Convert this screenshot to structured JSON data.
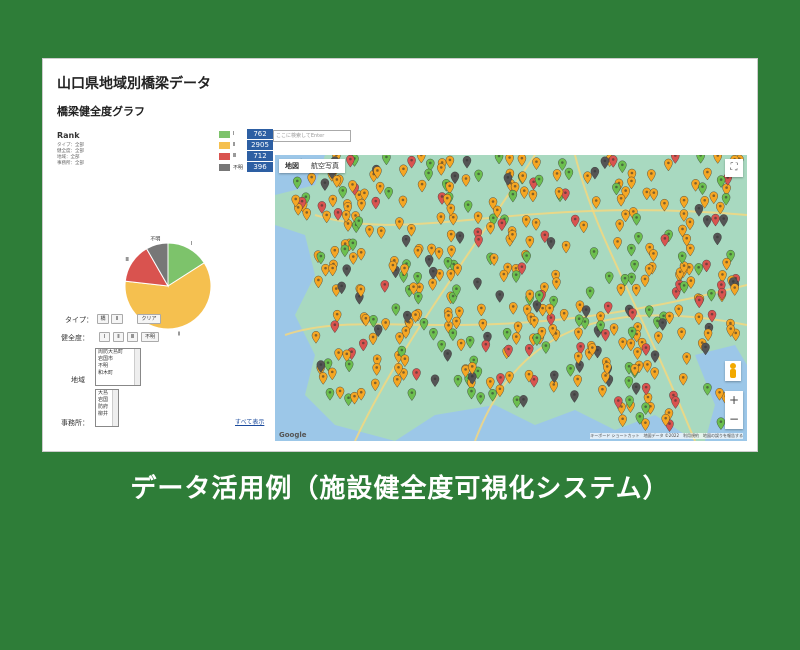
{
  "app": {
    "title": "山口県地域別橋梁データ",
    "subtitle": "橋梁健全度グラフ"
  },
  "rank": {
    "title": "Rank",
    "info": [
      "タイプ：全部",
      "健全度：全部",
      "地域：全部",
      "事務所：全部"
    ]
  },
  "chart_data": {
    "type": "pie",
    "categories": [
      "Ⅰ",
      "Ⅱ",
      "Ⅲ",
      "不明"
    ],
    "values": [
      762,
      2905,
      712,
      396
    ],
    "colors": [
      "#7dc36b",
      "#f5c04f",
      "#d9534f",
      "#777777"
    ]
  },
  "legend": [
    {
      "label": "Ⅰ",
      "value": "762",
      "color": "#7dc36b"
    },
    {
      "label": "Ⅱ",
      "value": "2905",
      "color": "#f5c04f"
    },
    {
      "label": "Ⅲ",
      "value": "712",
      "color": "#d9534f"
    },
    {
      "label": "不明",
      "value": "396",
      "color": "#777777"
    }
  ],
  "search": {
    "placeholder": "ここに検索してEnter"
  },
  "filters": {
    "type_label": "タイプ：",
    "type_chips": [
      "橋",
      "Ⅱ"
    ],
    "clear_label": "クリア",
    "health_label": "健全度：",
    "health_chips": [
      "Ⅰ",
      "Ⅱ",
      "Ⅲ",
      "不明"
    ],
    "region_label": "地域",
    "region_options": [
      "周防大島町",
      "岩国市",
      "不明",
      "和木町"
    ],
    "office_label": "事務所：",
    "office_options": [
      "大島",
      "岩国",
      "防府",
      "柳井"
    ],
    "show_all": "すべて表示"
  },
  "map": {
    "tab_map": "地図",
    "tab_aerial": "航空写真",
    "fullscreen": "⛶",
    "zoom_in": "+",
    "zoom_out": "−",
    "attribution": "キーボード ショートカット　地図データ ©2022　利用規約　地図の誤りを報告する",
    "google": "Google"
  },
  "caption": "データ活用例（施設健全度可視化システム）"
}
